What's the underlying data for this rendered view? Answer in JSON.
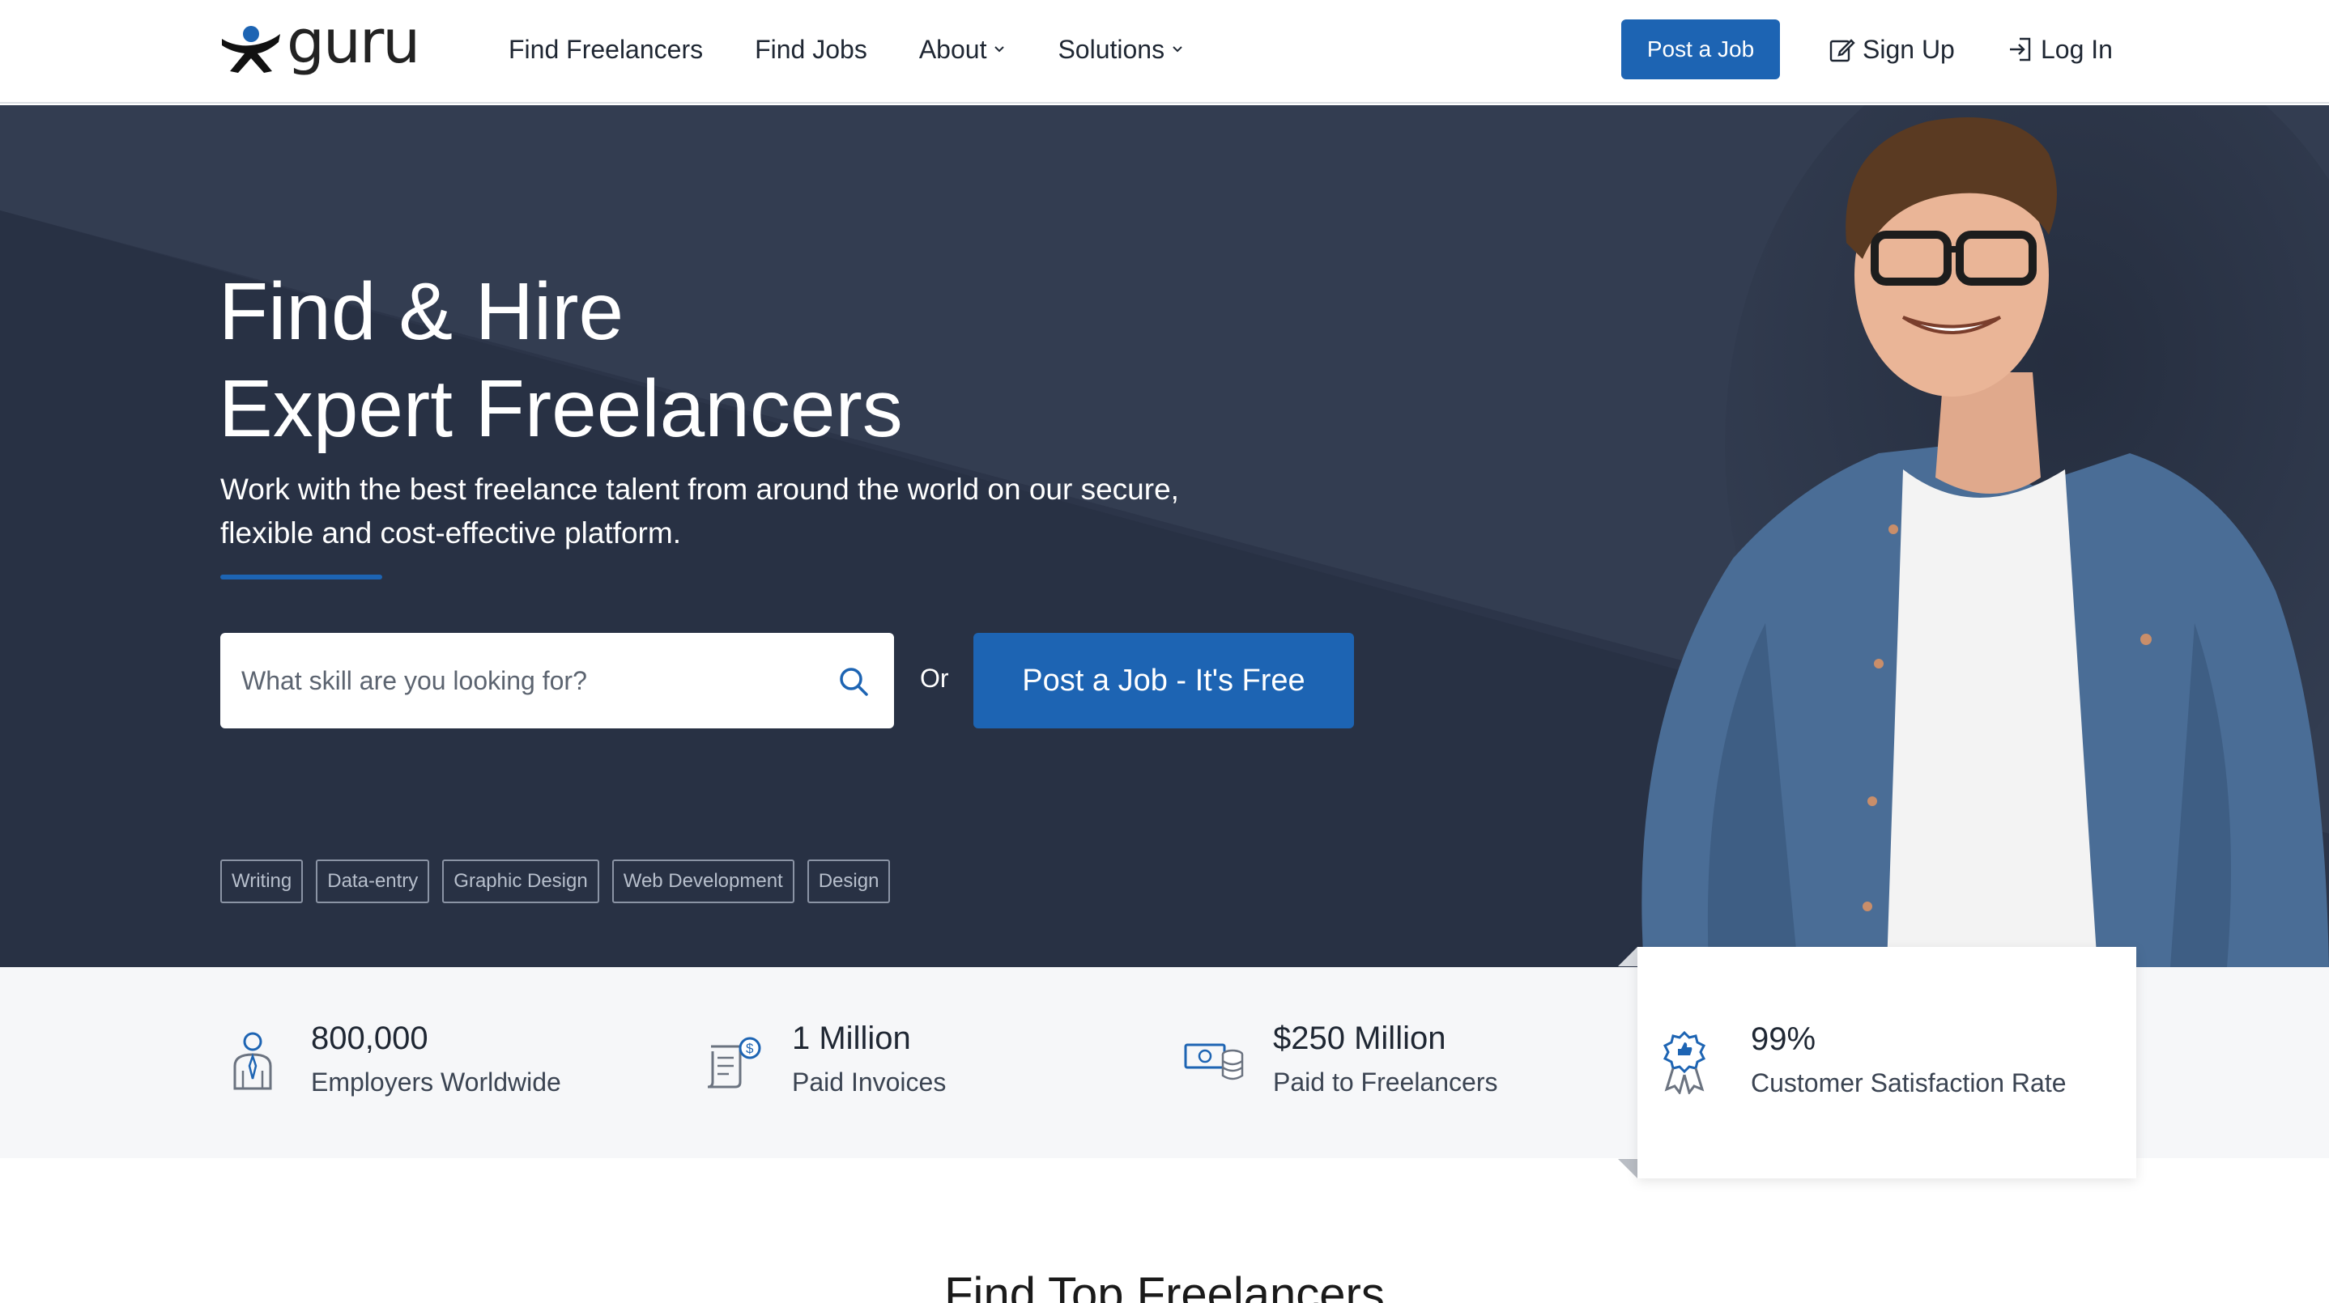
{
  "header": {
    "logo_text": "guru",
    "nav": [
      {
        "label": "Find Freelancers",
        "has_dropdown": false
      },
      {
        "label": "Find Jobs",
        "has_dropdown": false
      },
      {
        "label": "About",
        "has_dropdown": true
      },
      {
        "label": "Solutions",
        "has_dropdown": true
      }
    ],
    "post_job_label": "Post a Job",
    "sign_up_label": "Sign Up",
    "log_in_label": "Log In"
  },
  "hero": {
    "title_line1": "Find & Hire",
    "title_line2": "Expert Freelancers",
    "subtitle": "Work with the best freelance talent from around the world on our secure, flexible and cost-effective platform.",
    "search_placeholder": "What skill are you looking for?",
    "or_label": "Or",
    "post_job_label": "Post a Job - It's Free",
    "tags": [
      "Writing",
      "Data-entry",
      "Graphic Design",
      "Web Development",
      "Design"
    ]
  },
  "stats": [
    {
      "value": "800,000",
      "label": "Employers Worldwide",
      "icon": "employer-icon"
    },
    {
      "value": "1 Million",
      "label": "Paid Invoices",
      "icon": "invoice-icon"
    },
    {
      "value": "$250 Million",
      "label": "Paid to Freelancers",
      "icon": "money-icon"
    },
    {
      "value": "99%",
      "label": "Customer Satisfaction Rate",
      "icon": "award-icon"
    }
  ],
  "section": {
    "title": "Find Top Freelancers"
  },
  "colors": {
    "brand_blue": "#1d64b3",
    "hero_dark": "#2c3549",
    "hero_darker": "#262e40",
    "stats_bg": "#f6f7f9"
  }
}
